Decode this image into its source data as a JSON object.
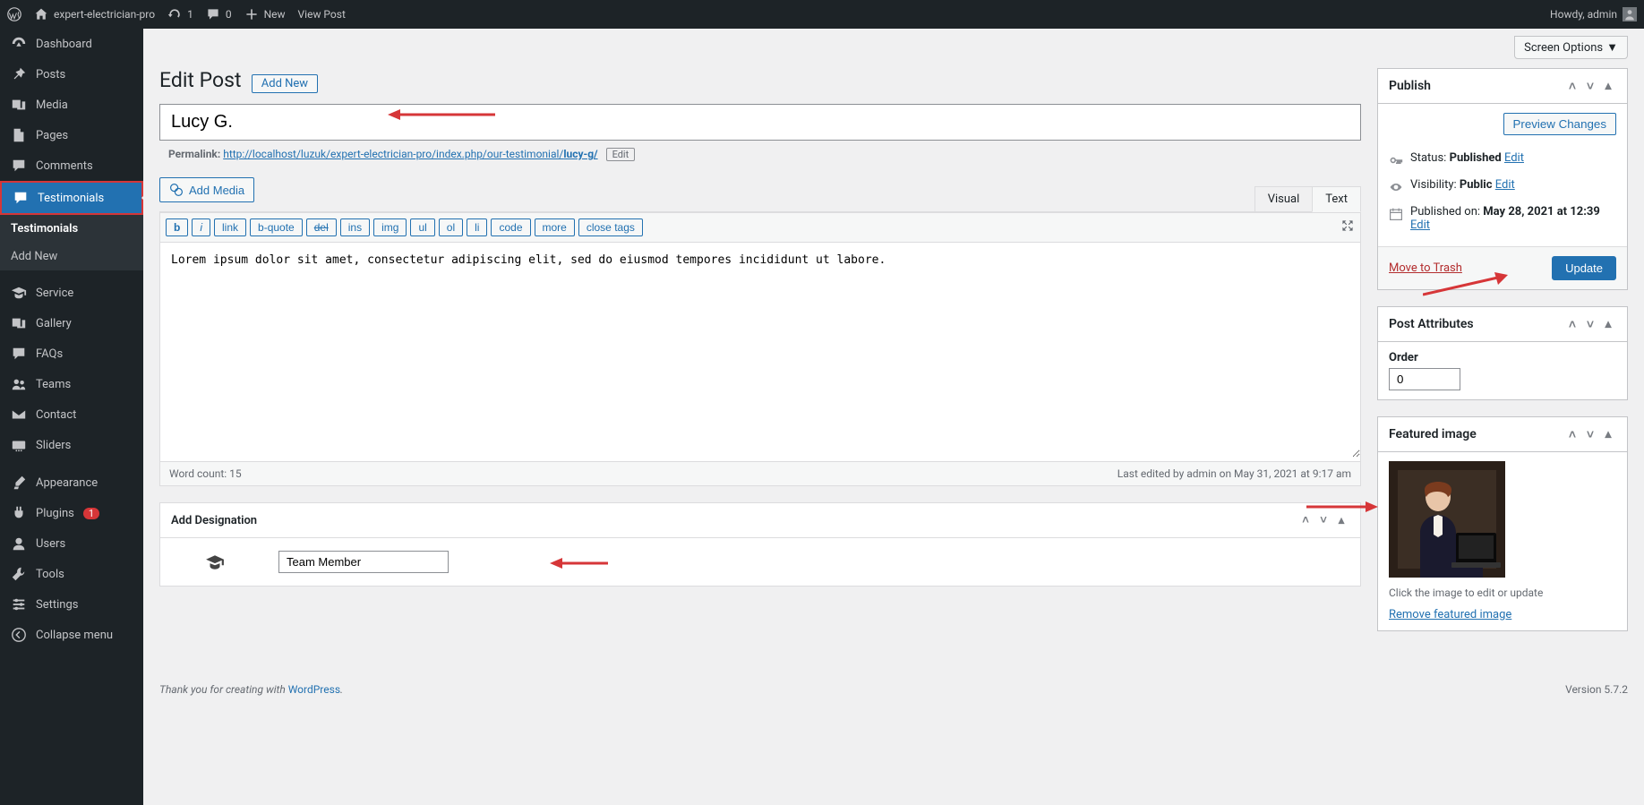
{
  "toolbar": {
    "site_name": "expert-electrician-pro",
    "updates": "1",
    "comments": "0",
    "new_label": "New",
    "view_post": "View Post",
    "howdy": "Howdy, admin"
  },
  "sidebar": [
    {
      "label": "Dashboard",
      "icon": "dashboard"
    },
    {
      "label": "Posts",
      "icon": "pin"
    },
    {
      "label": "Media",
      "icon": "media"
    },
    {
      "label": "Pages",
      "icon": "page"
    },
    {
      "label": "Comments",
      "icon": "comment"
    },
    {
      "label": "Testimonials",
      "icon": "testimonial",
      "active": true,
      "submenu": [
        "Testimonials",
        "Add New"
      ]
    },
    {
      "label": "Service",
      "icon": "cap"
    },
    {
      "label": "Gallery",
      "icon": "gallery"
    },
    {
      "label": "FAQs",
      "icon": "faq"
    },
    {
      "label": "Teams",
      "icon": "team"
    },
    {
      "label": "Contact",
      "icon": "mail"
    },
    {
      "label": "Sliders",
      "icon": "slider"
    },
    {
      "label": "Appearance",
      "icon": "brush"
    },
    {
      "label": "Plugins",
      "icon": "plugin",
      "badge": "1"
    },
    {
      "label": "Users",
      "icon": "user"
    },
    {
      "label": "Tools",
      "icon": "tool"
    },
    {
      "label": "Settings",
      "icon": "settings"
    },
    {
      "label": "Collapse menu",
      "icon": "collapse"
    }
  ],
  "screen_options": "Screen Options",
  "page": {
    "title": "Edit Post",
    "add_new": "Add New",
    "post_title": "Lucy G.",
    "permalink_label": "Permalink:",
    "permalink_base": "http://localhost/luzuk/expert-electrician-pro/index.php/our-testimonial/",
    "permalink_slug": "lucy-g/",
    "permalink_edit": "Edit",
    "add_media": "Add Media",
    "tabs": {
      "visual": "Visual",
      "text": "Text"
    },
    "ed_buttons": [
      "b",
      "i",
      "link",
      "b-quote",
      "del",
      "ins",
      "img",
      "ul",
      "ol",
      "li",
      "code",
      "more",
      "close tags"
    ],
    "content": "Lorem ipsum dolor sit amet, consectetur adipiscing elit, sed do eiusmod tempores incididunt ut labore.",
    "word_count_label": "Word count: 15",
    "last_edited": "Last edited by admin on May 31, 2021 at 9:17 am"
  },
  "designation": {
    "title": "Add Designation",
    "value": "Team Member"
  },
  "publish": {
    "title": "Publish",
    "preview": "Preview Changes",
    "status_label": "Status:",
    "status_value": "Published",
    "visibility_label": "Visibility:",
    "visibility_value": "Public",
    "published_label": "Published on:",
    "published_value": "May 28, 2021 at 12:39",
    "edit": "Edit",
    "trash": "Move to Trash",
    "update": "Update"
  },
  "post_attr": {
    "title": "Post Attributes",
    "order_label": "Order",
    "order_value": "0"
  },
  "featured": {
    "title": "Featured image",
    "hint": "Click the image to edit or update",
    "remove": "Remove featured image"
  },
  "footer": {
    "thanks_prefix": "Thank you for creating with ",
    "wp": "WordPress",
    "version": "Version 5.7.2"
  }
}
